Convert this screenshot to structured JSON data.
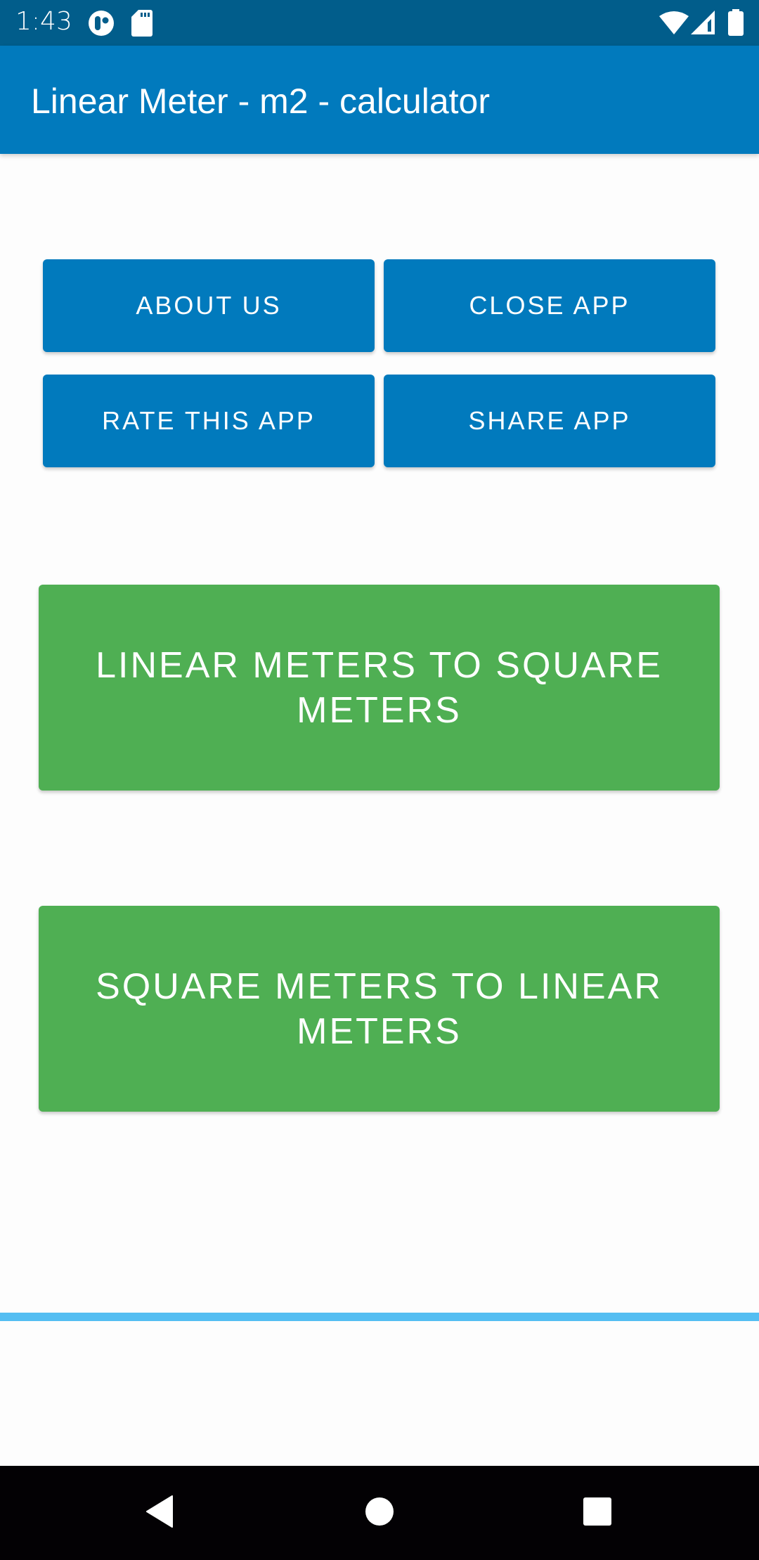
{
  "status_bar": {
    "time": "1:43",
    "left_icons": [
      "notification-app-icon",
      "sd-card-icon"
    ],
    "right_icons": [
      "wifi-icon",
      "cellular-signal-icon",
      "battery-icon"
    ]
  },
  "app_bar": {
    "title": "Linear Meter - m2 - calculator"
  },
  "buttons": {
    "about_us": "ABOUT US",
    "close_app": "CLOSE APP",
    "rate_app": "RATE THIS APP",
    "share_app": "SHARE APP",
    "linear_to_square": "LINEAR METERS TO SQUARE METERS",
    "square_to_linear": "SQUARE METERS TO LINEAR METERS"
  },
  "colors": {
    "status_bar": "#015d8b",
    "primary": "#017abd",
    "green": "#4faf53",
    "accent_line": "#54bef2",
    "background": "#fdfdfd"
  },
  "nav_bar": {
    "buttons": [
      "back",
      "home",
      "recents"
    ]
  }
}
